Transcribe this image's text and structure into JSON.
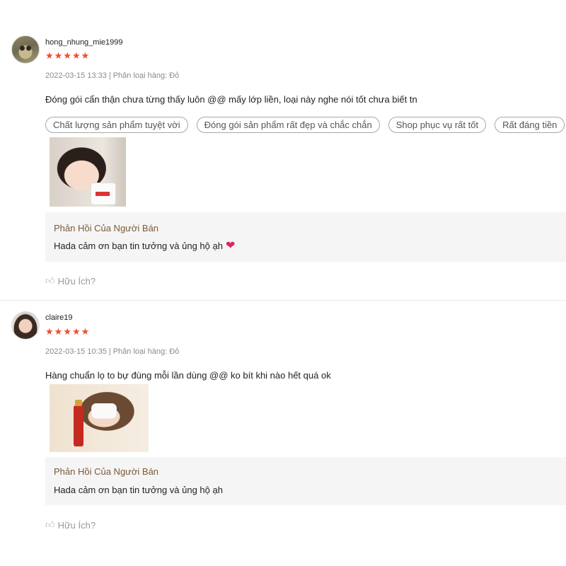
{
  "reviews": [
    {
      "avatar_icon": "cat-avatar",
      "username": "hong_nhung_mie1999",
      "rating": 5,
      "date": "2022-03-15 13:33",
      "variation": "Phân loại hàng: Đỏ",
      "comment": "Đóng gói cẩn thận chưa từng thấy luôn @@ mấy lớp liền, loại này nghe nói tốt chưa biết tn",
      "tags": [
        "Chất lượng sản phẩm tuyệt vời",
        "Đóng gói sản phẩm rất đẹp và chắc chắn",
        "Shop phục vụ rất tốt",
        "Rất đáng tiền"
      ],
      "reply": {
        "title": "Phản Hồi Của Người Bán",
        "text": "Hada cảm ơn bạn tin tưởng và ủng hộ ạh",
        "icon": "heart-icon"
      },
      "helpful_label": "Hữu Ích?"
    },
    {
      "avatar_icon": "girl-avatar",
      "username": "claire19",
      "rating": 5,
      "date": "2022-03-15 10:35",
      "variation": "Phân loại hàng: Đỏ",
      "comment": "Hàng chuẩn lọ to bự đùng mỗi lần dùng @@ ko bít khi nào hết quá ok",
      "tags": [],
      "reply": {
        "title": "Phản Hồi Của Người Bán",
        "text": "Hada cảm ơn bạn tin tưởng và ủng hộ ạh"
      },
      "helpful_label": "Hữu Ích?"
    }
  ],
  "colors": {
    "star": "#ee4d2d",
    "reply_title": "#7a5a3a",
    "reply_bg": "#f5f5f5",
    "muted": "#8a8a8a"
  }
}
